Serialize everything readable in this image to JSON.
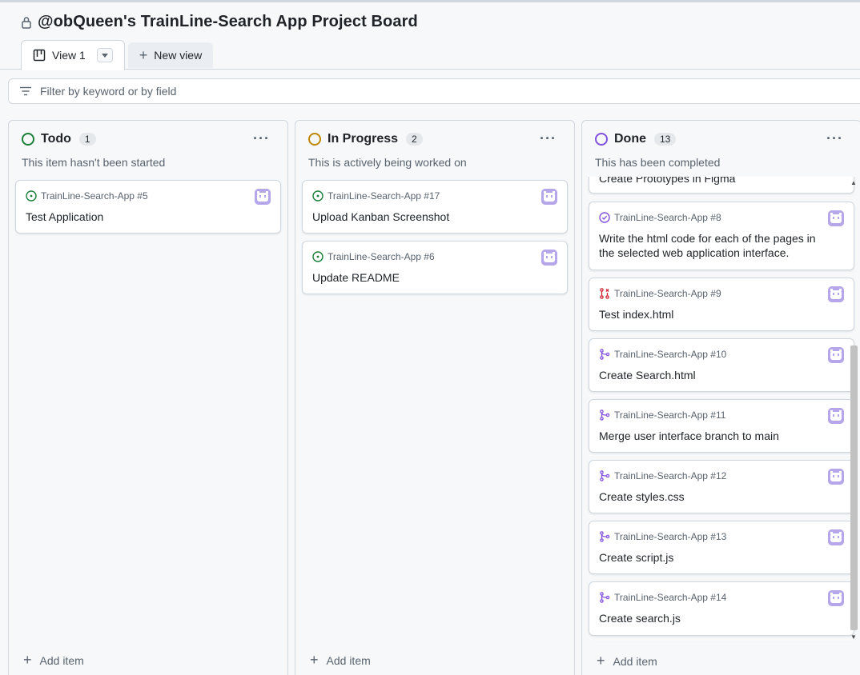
{
  "header": {
    "title": "@obQueen's TrainLine-Search App Project Board",
    "tabs": [
      {
        "label": "View 1"
      },
      {
        "label": "New view"
      }
    ]
  },
  "filter": {
    "placeholder": "Filter by keyword or by field"
  },
  "colors": {
    "todo": "#1a7f37",
    "in_progress": "#bf8700",
    "done": "#8250df",
    "closed_pr": "#cf222e",
    "border": "#d0d7de",
    "muted": "#59636e"
  },
  "columns": [
    {
      "name": "Todo",
      "count": "1",
      "description": "This item hasn't been started",
      "add_label": "Add item",
      "cards": [
        {
          "repo": "TrainLine-Search-App #5",
          "title": "Test Application",
          "icon": "open-issue-icon"
        }
      ]
    },
    {
      "name": "In Progress",
      "count": "2",
      "description": "This is actively being worked on",
      "add_label": "Add item",
      "cards": [
        {
          "repo": "TrainLine-Search-App #17",
          "title": "Upload Kanban Screenshot",
          "icon": "open-issue-icon"
        },
        {
          "repo": "TrainLine-Search-App #6",
          "title": "Update README",
          "icon": "open-issue-icon"
        }
      ]
    },
    {
      "name": "Done",
      "count": "13",
      "description": "This has been completed",
      "add_label": "Add item",
      "cards": [
        {
          "repo": "",
          "title": "Create Prototypes in Figma",
          "icon": ""
        },
        {
          "repo": "TrainLine-Search-App #8",
          "title": "Write the html code for each of the pages in the selected web application interface.",
          "icon": "completed-issue-icon"
        },
        {
          "repo": "TrainLine-Search-App #9",
          "title": "Test index.html",
          "icon": "closed-pr-icon"
        },
        {
          "repo": "TrainLine-Search-App #10",
          "title": "Create Search.html",
          "icon": "merged-pr-icon"
        },
        {
          "repo": "TrainLine-Search-App #11",
          "title": "Merge user interface branch to main",
          "icon": "merged-pr-icon"
        },
        {
          "repo": "TrainLine-Search-App #12",
          "title": "Create styles.css",
          "icon": "merged-pr-icon"
        },
        {
          "repo": "TrainLine-Search-App #13",
          "title": "Create script.js",
          "icon": "merged-pr-icon"
        },
        {
          "repo": "TrainLine-Search-App #14",
          "title": "Create search.js",
          "icon": "merged-pr-icon"
        }
      ]
    }
  ]
}
